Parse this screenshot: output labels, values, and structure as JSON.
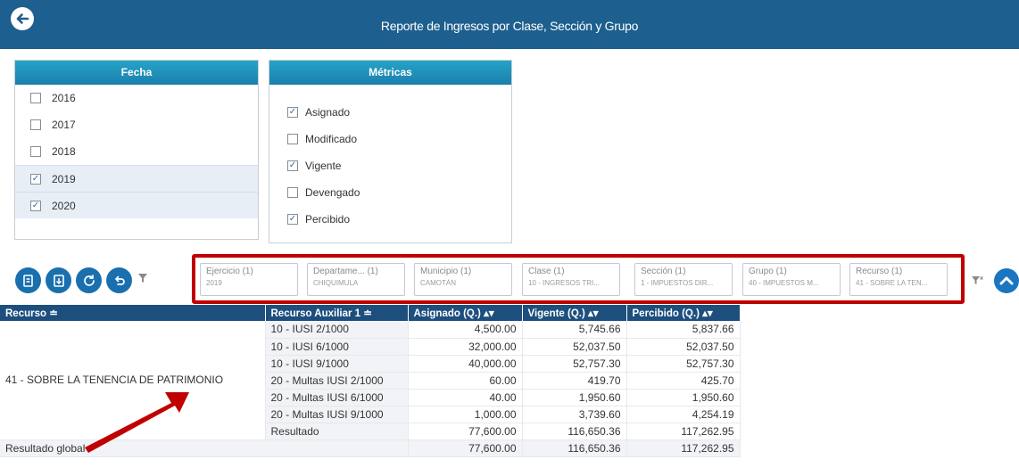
{
  "header": {
    "title": "Reporte de Ingresos por Clase, Sección y Grupo"
  },
  "fecha": {
    "title": "Fecha",
    "items": [
      {
        "label": "2016",
        "checked": ""
      },
      {
        "label": "2017",
        "checked": ""
      },
      {
        "label": "2018",
        "checked": ""
      },
      {
        "label": "2019",
        "checked": "✓"
      },
      {
        "label": "2020",
        "checked": "✓"
      }
    ]
  },
  "metricas": {
    "title": "Métricas",
    "items": [
      {
        "label": "Asignado",
        "checked": "✓"
      },
      {
        "label": "Modificado",
        "checked": ""
      },
      {
        "label": "Vigente",
        "checked": "✓"
      },
      {
        "label": "Devengado",
        "checked": ""
      },
      {
        "label": "Percibido",
        "checked": "✓"
      }
    ]
  },
  "filters": [
    {
      "title": "Ejercicio (1)",
      "value": "2019"
    },
    {
      "title": "Departame... (1)",
      "value": "CHIQUIMULA"
    },
    {
      "title": "Municipio (1)",
      "value": "CAMOTÁN"
    },
    {
      "title": "Clase (1)",
      "value": "10 - INGRESOS TRI..."
    },
    {
      "title": "Sección (1)",
      "value": "1 - IMPUESTOS DIR..."
    },
    {
      "title": "Grupo (1)",
      "value": "40 - IMPUESTOS M..."
    },
    {
      "title": "Recurso (1)",
      "value": "41 - SOBRE LA TEN..."
    }
  ],
  "table": {
    "headers": [
      "Recurso",
      "Recurso Auxiliar 1",
      "Asignado (Q.)",
      "Vigente (Q.)",
      "Percibido (Q.)"
    ],
    "recurso": "41 - SOBRE LA TENENCIA DE PATRIMONIO",
    "rows": [
      {
        "aux": "10 - IUSI 2/1000",
        "asignado": "4,500.00",
        "vigente": "5,745.66",
        "percibido": "5,837.66"
      },
      {
        "aux": "10 - IUSI 6/1000",
        "asignado": "32,000.00",
        "vigente": "52,037.50",
        "percibido": "52,037.50"
      },
      {
        "aux": "10 - IUSI 9/1000",
        "asignado": "40,000.00",
        "vigente": "52,757.30",
        "percibido": "52,757.30"
      },
      {
        "aux": "20 - Multas IUSI 2/1000",
        "asignado": "60.00",
        "vigente": "419.70",
        "percibido": "425.70"
      },
      {
        "aux": "20 - Multas IUSI 6/1000",
        "asignado": "40.00",
        "vigente": "1,950.60",
        "percibido": "1,950.60"
      },
      {
        "aux": "20 - Multas IUSI 9/1000",
        "asignado": "1,000.00",
        "vigente": "3,739.60",
        "percibido": "4,254.19"
      }
    ],
    "resultado": {
      "label": "Resultado",
      "asignado": "77,600.00",
      "vigente": "116,650.36",
      "percibido": "117,262.95"
    },
    "global": {
      "label": "Resultado global",
      "asignado": "77,600.00",
      "vigente": "116,650.36",
      "percibido": "117,262.95"
    }
  },
  "colors": {
    "header": "#1d5f8e",
    "panel_head": "#1a7fae",
    "table_head": "#1d4f7e",
    "annotation": "#c00000"
  }
}
